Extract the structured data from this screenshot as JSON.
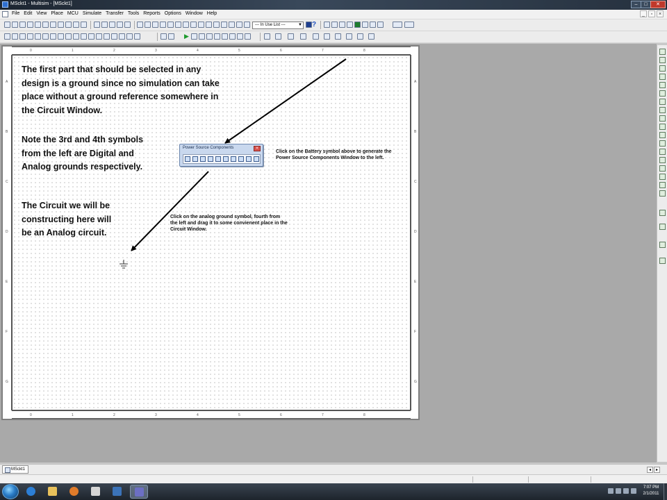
{
  "window": {
    "title": "MSckt1 - Multisim - [MSckt1]",
    "controls": {
      "minimize": "–",
      "maximize": "□",
      "close": "✕"
    }
  },
  "menubar": {
    "items": [
      "File",
      "Edit",
      "View",
      "Place",
      "MCU",
      "Simulate",
      "Transfer",
      "Tools",
      "Reports",
      "Options",
      "Window",
      "Help"
    ],
    "mdi_controls": [
      "_",
      "▫",
      "×"
    ]
  },
  "toolbar": {
    "in_use_list": "--- In Use List ---",
    "help_glyph": "?"
  },
  "circuit_window": {
    "ruler_columns": [
      "0",
      "1",
      "2",
      "3",
      "4",
      "5",
      "6",
      "7",
      "8"
    ],
    "ruler_rows": [
      "A",
      "B",
      "C",
      "D",
      "E",
      "F",
      "G"
    ],
    "notes": {
      "ground_intro": "The first part that should be selected in any design is a ground since no simulation can take place without a ground reference somewhere in the Circuit Window.",
      "ground_symbols": "Note the 3rd and 4th symbols from the left are Digital and Analog grounds respectively.",
      "circuit_type": "The Circuit we will be constructing here will be an Analog circuit.",
      "battery_instruction": "Click on the Battery symbol above to generate the Power Source Components Window to the left.",
      "drag_instruction": "Click on the analog ground symbol, fourth from the left and drag it to some convienent place in the Circuit Window."
    },
    "power_source_dialog": {
      "title": "Power Source Components",
      "close": "×",
      "icon_count": 10
    },
    "placed_part": "analog-ground-icon"
  },
  "sheet_tabs": [
    "MSckt1"
  ],
  "taskbar": {
    "apps": [
      "internet-explorer-icon",
      "file-explorer-icon",
      "media-player-icon",
      "paint-icon",
      "security-icon",
      "multisim-icon"
    ],
    "active_app": "multisim-icon",
    "clock_time": "7:07 PM",
    "clock_date": "2/1/2011"
  }
}
